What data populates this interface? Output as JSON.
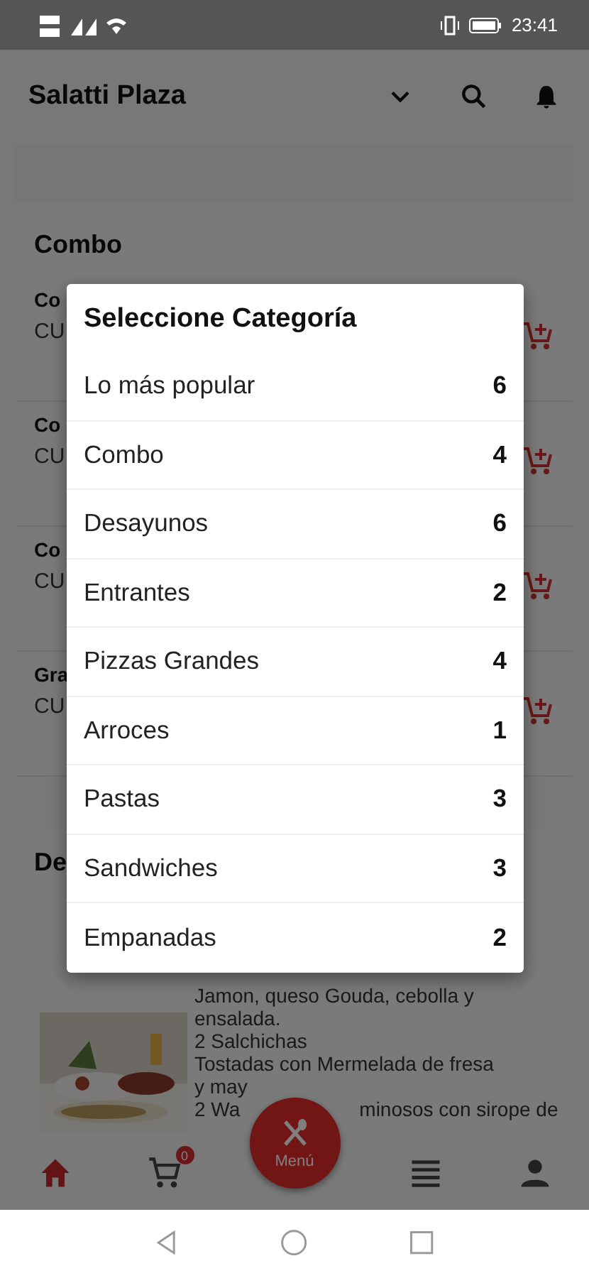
{
  "status_bar": {
    "time": "23:41"
  },
  "app_bar": {
    "title": "Salatti Plaza"
  },
  "combo_section": {
    "title": "Combo",
    "items": [
      {
        "name": "Co",
        "price": "CU"
      },
      {
        "name": "Co",
        "price": "CU"
      },
      {
        "name": "Co",
        "price": "CU"
      },
      {
        "name": "Gra",
        "price": "CU"
      }
    ]
  },
  "second_section": {
    "title": "De",
    "description_lines": [
      "Jamon, queso Gouda, cebolla y",
      "ensalada.",
      "2 Salchichas",
      "Tostadas con Mermelada de fresa",
      "y may"
    ],
    "description_tail": [
      "2 Wa",
      "minosos con sirope de"
    ]
  },
  "bottom_nav": [
    {
      "kind": "home",
      "selected": true
    },
    {
      "kind": "cart",
      "selected": false,
      "badge": "0"
    },
    {
      "kind": "fab",
      "selected": false,
      "label": "Menú"
    },
    {
      "kind": "list",
      "selected": false
    },
    {
      "kind": "account",
      "selected": false
    }
  ],
  "dialog": {
    "title": "Seleccione Categoría",
    "categories": [
      {
        "name": "Lo más popular",
        "count": "6"
      },
      {
        "name": "Combo",
        "count": "4"
      },
      {
        "name": "Desayunos",
        "count": "6"
      },
      {
        "name": "Entrantes",
        "count": "2"
      },
      {
        "name": "Pizzas Grandes",
        "count": "4"
      },
      {
        "name": "Arroces",
        "count": "1"
      },
      {
        "name": "Pastas",
        "count": "3"
      },
      {
        "name": "Sandwiches",
        "count": "3"
      },
      {
        "name": "Empanadas",
        "count": "2"
      }
    ]
  }
}
